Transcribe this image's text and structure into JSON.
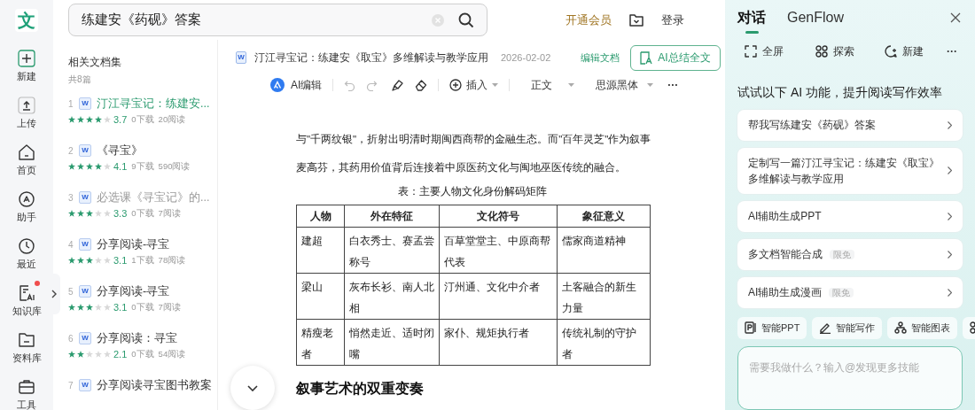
{
  "rail": {
    "logo": "文",
    "items": [
      {
        "kind": "plus",
        "label": "新建"
      },
      {
        "kind": "upload",
        "label": "上传"
      },
      {
        "kind": "home",
        "label": "首页"
      },
      {
        "kind": "assistant",
        "label": "助手"
      },
      {
        "kind": "clock",
        "label": "最近"
      },
      {
        "kind": "ai",
        "label": "知识库",
        "dot": true
      },
      {
        "kind": "folder",
        "label": "资料库"
      },
      {
        "kind": "toolbox",
        "label": "工具"
      }
    ]
  },
  "search": {
    "value": "练建安《药砚》答案"
  },
  "header": {
    "vip": "开通会员",
    "login": "登录"
  },
  "doc_list": {
    "title": "相关文档集",
    "count": "共8篇",
    "items": [
      {
        "index": "1",
        "file_badge": "W",
        "title": "汀江寻宝记：练建安...",
        "selected": true,
        "visited": false,
        "stars": 4,
        "score": "3.7",
        "downloads": "0下载",
        "reads": "20阅读"
      },
      {
        "index": "2",
        "file_badge": "W",
        "title": "《寻宝》",
        "selected": false,
        "visited": false,
        "stars": 4,
        "score": "4.1",
        "downloads": "9下载",
        "reads": "590阅读"
      },
      {
        "index": "3",
        "file_badge": "W",
        "title": "必选课《寻宝记》的...",
        "selected": false,
        "visited": true,
        "stars": 3,
        "score": "3.3",
        "downloads": "0下载",
        "reads": "7阅读"
      },
      {
        "index": "4",
        "file_badge": "W",
        "title": "分享阅读-寻宝",
        "selected": false,
        "visited": false,
        "stars": 3,
        "score": "3.1",
        "downloads": "1下载",
        "reads": "78阅读"
      },
      {
        "index": "5",
        "file_badge": "W",
        "title": "分享阅读-寻宝",
        "selected": false,
        "visited": false,
        "stars": 3,
        "score": "3.1",
        "downloads": "0下载",
        "reads": "7阅读"
      },
      {
        "index": "6",
        "file_badge": "W",
        "title": "分享阅读：寻宝",
        "selected": false,
        "visited": false,
        "stars": 2,
        "score": "2.1",
        "downloads": "0下载",
        "reads": "54阅读"
      },
      {
        "index": "7",
        "file_badge": "W",
        "title": "分享阅读寻宝图书教案",
        "selected": false,
        "visited": false
      }
    ]
  },
  "document": {
    "file_badge": "W",
    "title": "汀江寻宝记：练建安《取宝》多维解读与教学应用",
    "date": "2026-02-02",
    "edit_link": "编辑文档",
    "summary_button": "AI总结全文",
    "toolbar": {
      "ai_edit": "AI编辑",
      "insert": "插入",
      "style": "正文",
      "font": "思源黑体",
      "more": "···"
    },
    "lines": [
      "与\"千两纹银\"，折射出明清时期闽西商帮的金融生态。而\"百年灵芝\"作为叙事",
      "麦高芬，其药用价值背后连接着中原医药文化与闽地巫医传统的融合。"
    ],
    "table": {
      "caption": "表：主要人物文化身份解码矩阵",
      "columns": [
        "人物",
        "外在特征",
        "文化符号",
        "象征意义"
      ],
      "rows": [
        [
          "建超",
          "白衣秀士、赛孟尝称号",
          "百草堂堂主、中原商帮代表",
          "儒家商道精神"
        ],
        [
          "梁山",
          "灰布长衫、南人北相",
          "汀州通、文化中介者",
          "土客融合的新生力量"
        ],
        [
          "精瘦老者",
          "悄然走近、适时闭嘴",
          "家仆、规矩执行者",
          "传统礼制的守护者"
        ]
      ]
    },
    "heading": "叙事艺术的双重变奏"
  },
  "assistant": {
    "tabs": [
      {
        "label": "对话",
        "selected": true
      },
      {
        "label": "GenFlow",
        "selected": false
      }
    ],
    "actions": [
      {
        "kind": "fullscreen",
        "label": "全屏"
      },
      {
        "kind": "explore",
        "label": "探索"
      },
      {
        "kind": "new",
        "label": "新建"
      },
      {
        "kind": "more",
        "label": "···"
      }
    ],
    "heading": "试试以下 AI 功能，提升阅读写作效率",
    "suggestions": [
      {
        "text": "帮我写练建安《药砚》答案"
      },
      {
        "text": "定制写一篇汀江寻宝记：练建安《取宝》多维解读与教学应用"
      },
      {
        "text": "AI辅助生成PPT"
      },
      {
        "text": "多文档智能合成",
        "badge": "限免"
      },
      {
        "text": "AI辅助生成漫画",
        "badge": "限免"
      }
    ],
    "chips": [
      {
        "kind": "ppt",
        "label": "智能PPT"
      },
      {
        "kind": "pen",
        "label": "智能写作"
      },
      {
        "kind": "chart",
        "label": "智能图表"
      },
      {
        "kind": "grid"
      }
    ],
    "input": {
      "placeholder": "需要我做什么？输入@发现更多技能"
    }
  }
}
